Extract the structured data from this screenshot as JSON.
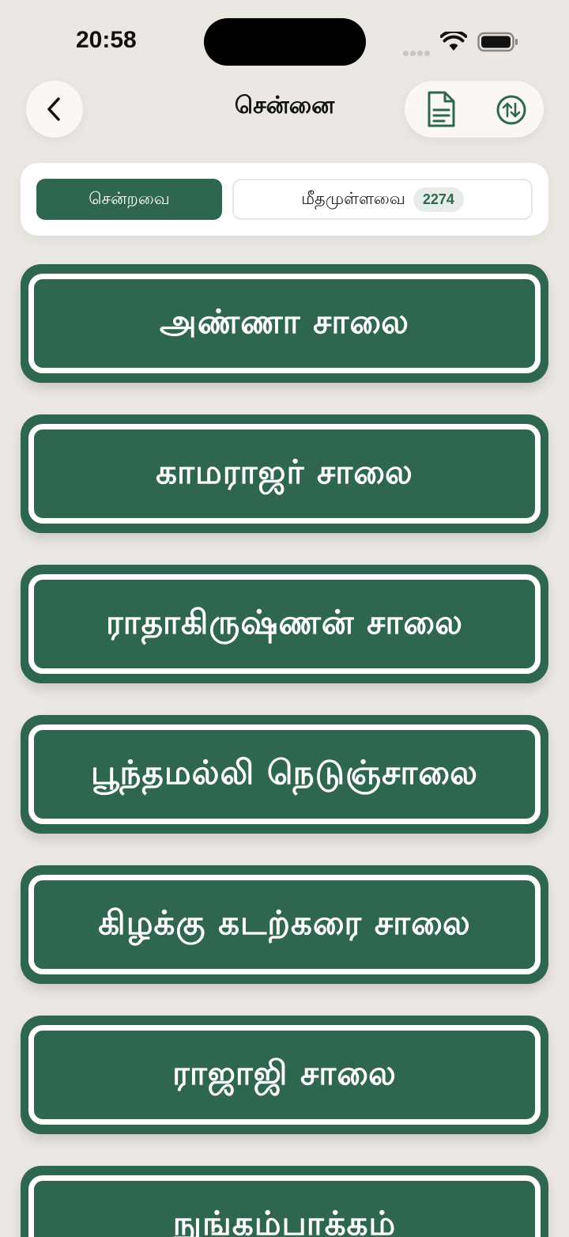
{
  "status_bar": {
    "time": "20:58"
  },
  "header": {
    "title": "சென்னை"
  },
  "segments": {
    "visited_label": "சென்றவை",
    "remaining_label": "மீதமுள்ளவை",
    "remaining_count": "2274"
  },
  "streets": [
    "அண்ணா சாலை",
    "காமராஜர் சாலை",
    "ராதாகிருஷ்ணன் சாலை",
    "பூந்தமல்லி நெடுஞ்சாலை",
    "கிழக்கு கடற்கரை சாலை",
    "ராஜாஜி சாலை",
    "நுங்கம்பாக்கம்"
  ],
  "colors": {
    "background": "#ebe7e3",
    "sign_green": "#2e6650",
    "card": "#ffffff"
  },
  "icons": [
    "back-chevron-icon",
    "document-icon",
    "sort-arrows-icon",
    "wifi-icon",
    "battery-icon"
  ]
}
